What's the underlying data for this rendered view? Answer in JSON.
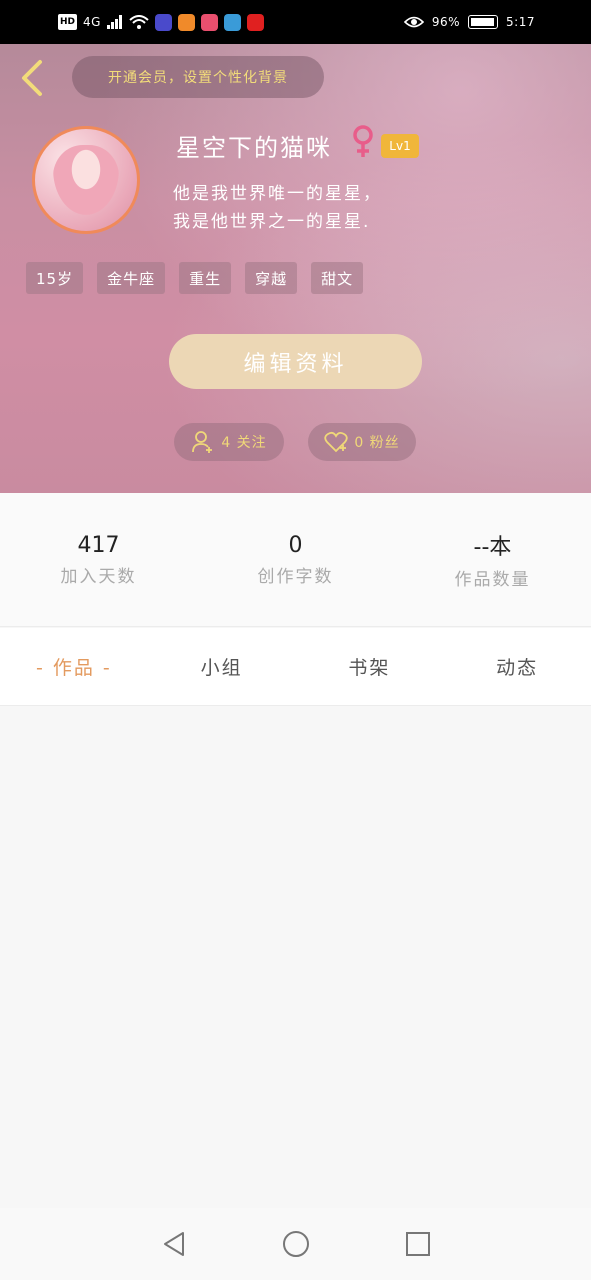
{
  "status_bar": {
    "network": "4G",
    "battery_percent": "96%",
    "time": "5:17"
  },
  "header": {
    "member_prompt": "开通会员，设置个性化背景",
    "username": "星空下的猫咪",
    "level": "Lv1",
    "bio_line1": "他是我世界唯一的星星，",
    "bio_line2": "我是他世界之一的星星.",
    "tags": [
      "15岁",
      "金牛座",
      "重生",
      "穿越",
      "甜文"
    ],
    "edit_button": "编辑资料",
    "following_label": "4 关注",
    "fans_label": "0 粉丝"
  },
  "stats": [
    {
      "value": "417",
      "label": "加入天数"
    },
    {
      "value": "0",
      "label": "创作字数"
    },
    {
      "value": "--本",
      "label": "作品数量"
    }
  ],
  "tabs": {
    "works": "作品",
    "group": "小组",
    "bookshelf": "书架",
    "activity": "动态",
    "active_dash": "-"
  },
  "colors": {
    "accent_orange": "#e39a5f",
    "gold_text": "#f2dc7a",
    "level_badge": "#f0b63a",
    "edit_button_bg": "#ecd7b5"
  }
}
